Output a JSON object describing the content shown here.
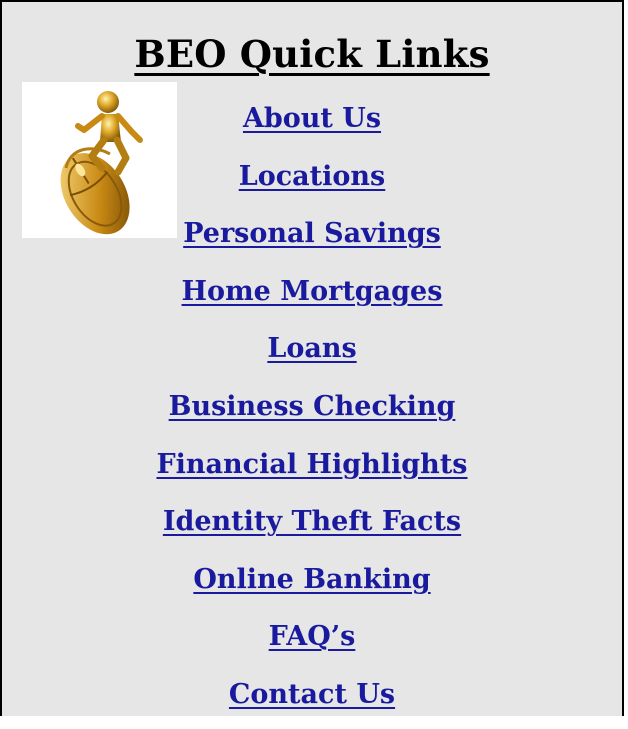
{
  "panel": {
    "title": "BEO Quick Links",
    "logo_icon": "gold-figure-surfing-computer-mouse-icon",
    "link_color": "#1a1a9e"
  },
  "links": [
    {
      "label": "About Us"
    },
    {
      "label": "Locations"
    },
    {
      "label": "Personal Savings"
    },
    {
      "label": "Home Mortgages"
    },
    {
      "label": "Loans"
    },
    {
      "label": "Business Checking"
    },
    {
      "label": "Financial Highlights"
    },
    {
      "label": "Identity Theft Facts"
    },
    {
      "label": "Online Banking"
    },
    {
      "label": "FAQ’s"
    },
    {
      "label": "Contact Us"
    }
  ]
}
